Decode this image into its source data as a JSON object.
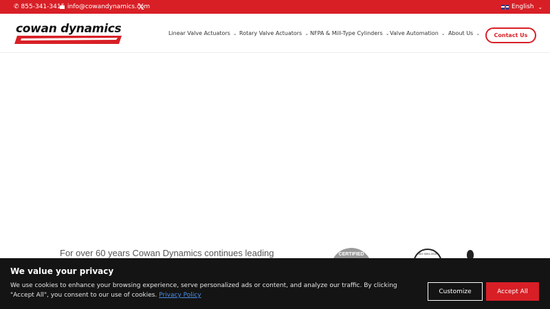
{
  "topbar": {
    "phone": "855-341-3415",
    "email": "info@cowandynamics.com",
    "social_icon": "x-twitter-icon",
    "language": "English"
  },
  "header": {
    "logo_text": "cowan dynamics",
    "nav": [
      {
        "label": "Linear Valve Actuators"
      },
      {
        "label": "Rotary Valve Actuators"
      },
      {
        "label": "NFPA & Mill-Type Cylinders"
      },
      {
        "label": "Valve Automation"
      },
      {
        "label": "About Us"
      }
    ],
    "contact_label": "Contact Us"
  },
  "main": {
    "tagline": "For over 60 years Cowan Dynamics continues leading",
    "badge_certified": "CERTIFIED",
    "badge_iso": "ISO 9001:2015"
  },
  "cookie": {
    "title": "We value your privacy",
    "text": "We use cookies to enhance your browsing experience, serve personalized ads or content, and analyze our traffic. By clicking \"Accept All\", you consent to our use of cookies.",
    "link": "Privacy Policy",
    "customize_label": "Customize",
    "accept_label": "Accept All"
  },
  "colors": {
    "brand_red": "#d81f26",
    "banner_bg": "#141414"
  }
}
